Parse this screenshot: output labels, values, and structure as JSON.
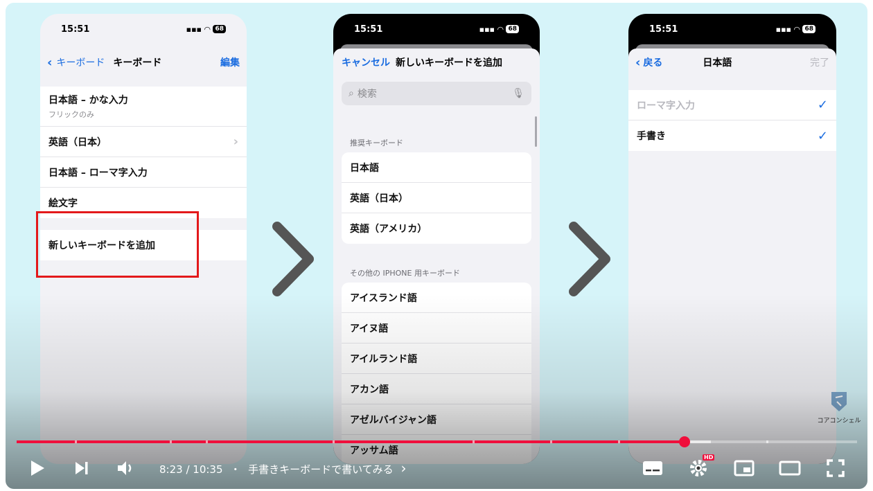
{
  "phone1": {
    "status_time": "15:51",
    "battery": "68",
    "nav_back": "キーボード",
    "nav_title": "キーボード",
    "nav_edit": "編集",
    "kb_list": [
      {
        "label": "日本語 – かな入力",
        "sub": "フリックのみ"
      },
      {
        "label": "英語（日本）",
        "sub": ""
      },
      {
        "label": "日本語 – ローマ字入力",
        "sub": ""
      },
      {
        "label": "絵文字",
        "sub": ""
      }
    ],
    "add_keyboard": "新しいキーボードを追加"
  },
  "phone2": {
    "status_time": "15:51",
    "battery": "68",
    "cancel": "キャンセル",
    "title": "新しいキーボードを追加",
    "search_placeholder": "検索",
    "section_recommended": "推奨キーボード",
    "recommended": [
      "日本語",
      "英語（日本）",
      "英語（アメリカ）"
    ],
    "section_other": "その他の IPHONE 用キーボード",
    "other": [
      "アイスランド語",
      "アイヌ語",
      "アイルランド語",
      "アカン語",
      "アゼルバイジャン語",
      "アッサム語"
    ]
  },
  "phone3": {
    "status_time": "15:51",
    "battery": "68",
    "back": "戻る",
    "title": "日本語",
    "done": "完了",
    "options": [
      {
        "label": "ローマ字入力",
        "checked": true,
        "dim": true
      },
      {
        "label": "手書き",
        "checked": true,
        "dim": false
      }
    ]
  },
  "watermark": {
    "text": "コアコンシェル"
  },
  "player": {
    "current_time": "8:23",
    "duration": "10:35",
    "time_separator": " / ",
    "bullet": "・",
    "chapter_title": "手書きキーボードで書いてみる",
    "chapter_chevron": "›",
    "hd_badge": "HD",
    "progress_fraction": 0.7949,
    "buffer_fraction": 0.826
  },
  "colors": {
    "accent_blue": "#1a6ce0",
    "progress_red": "#f00f3c",
    "highlight_red": "#e3191b",
    "background": "#d6f4f9"
  }
}
